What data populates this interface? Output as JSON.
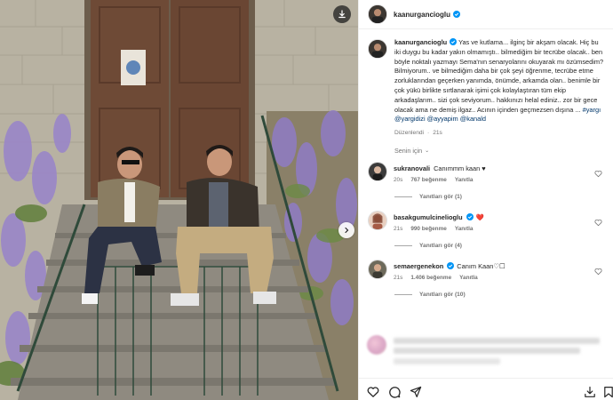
{
  "post": {
    "username": "kaanurgancioglu",
    "verified": true,
    "caption": {
      "username": "kaanurgancioglu",
      "text": "Yas ve kutlama... ilginç bir akşam olacak. Hiç bu iki duygu bu kadar yakın olmamıştı.. bilmediğim bir tecrübe olacak.. ben böyle noktalı yazmayı Sema'nın senaryolarını okuyarak mı özümsedim? Bilmiyorum.. ve bilmediğim daha bir çok şeyi öğrenme, tecrübe etme zorluklarından geçerken yanımda, önümde, arkamda olan.. benimle bir çok yükü birlikte sırtlanarak işimi çok kolaylaştıran tüm ekip arkadaşlarım.. sizi çok seviyorum.. hakkınızı helal ediniz.. zor bir gece olacak ama ne demiş ilgaz.. Acının içinden geçmezsen dışına ...",
      "hashtags": "#yargı",
      "mentions": "@yargidizi @ayyapim @kanald"
    },
    "edited_label": "Düzenlendi",
    "time_ago": "21s"
  },
  "for_you": {
    "label": "Senin için"
  },
  "comments": [
    {
      "username": "sukranovali",
      "text": "Canımmm kaan ♥",
      "time": "20s",
      "likes": "767 beğenme",
      "reply_label": "Yanıtla",
      "view_replies": "Yanıtları gör (1)",
      "avatar_color": "#3b3b3b"
    },
    {
      "username": "basakgumulcinelioglu",
      "text": "❤️",
      "time": "21s",
      "likes": "990 beğenme",
      "reply_label": "Yanıtla",
      "view_replies": "Yanıtları gör (4)",
      "avatar_color": "#c98a73"
    },
    {
      "username": "semaergenekon",
      "text": "Canım Kaan♡☐",
      "time": "21s",
      "likes": "1.406 beğenme",
      "reply_label": "Yanıtla",
      "view_replies": "Yanıtları gör (10)",
      "avatar_color": "#6d6a5b"
    }
  ],
  "icons": {
    "download": "download-icon",
    "next": "chevron-right-icon",
    "like": "heart-icon",
    "comment": "comment-icon",
    "share": "send-icon",
    "save_to_device": "download-tray-icon",
    "more": "more-icon",
    "verified": "verified-badge-icon"
  },
  "colors": {
    "verified_blue": "#0095f6",
    "link_blue": "#00376b",
    "muted_text": "#737373",
    "heart_red": "#ed4956"
  }
}
